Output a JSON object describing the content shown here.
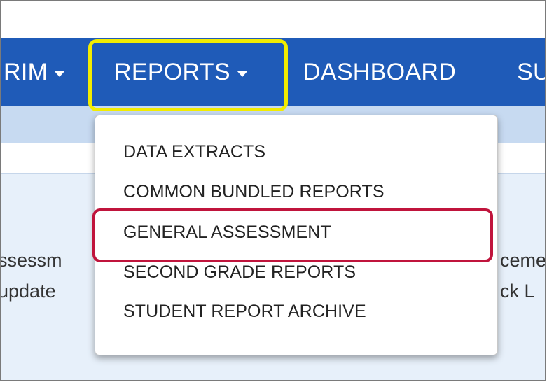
{
  "nav": {
    "items": [
      {
        "label": "RIM",
        "has_caret": true
      },
      {
        "label": "REPORTS",
        "has_caret": true
      },
      {
        "label": "DASHBOARD",
        "has_caret": false
      },
      {
        "label": "SU",
        "has_caret": false
      }
    ],
    "color": "#1f5bb8"
  },
  "reports_menu": {
    "items": [
      {
        "label": "DATA EXTRACTS"
      },
      {
        "label": "COMMON BUNDLED REPORTS"
      },
      {
        "label": "GENERAL ASSESSMENT"
      },
      {
        "label": "SECOND GRADE REPORTS"
      },
      {
        "label": "STUDENT REPORT ARCHIVE"
      }
    ],
    "highlighted_item": "GENERAL ASSESSMENT"
  },
  "content": {
    "left_fragments": [
      "ssessm",
      "update"
    ],
    "right_fragments": [
      "ceme",
      "ck L"
    ]
  },
  "highlight_colors": {
    "reports_outline": "#f2ec00",
    "menu_item_outline": "#c0143c"
  }
}
